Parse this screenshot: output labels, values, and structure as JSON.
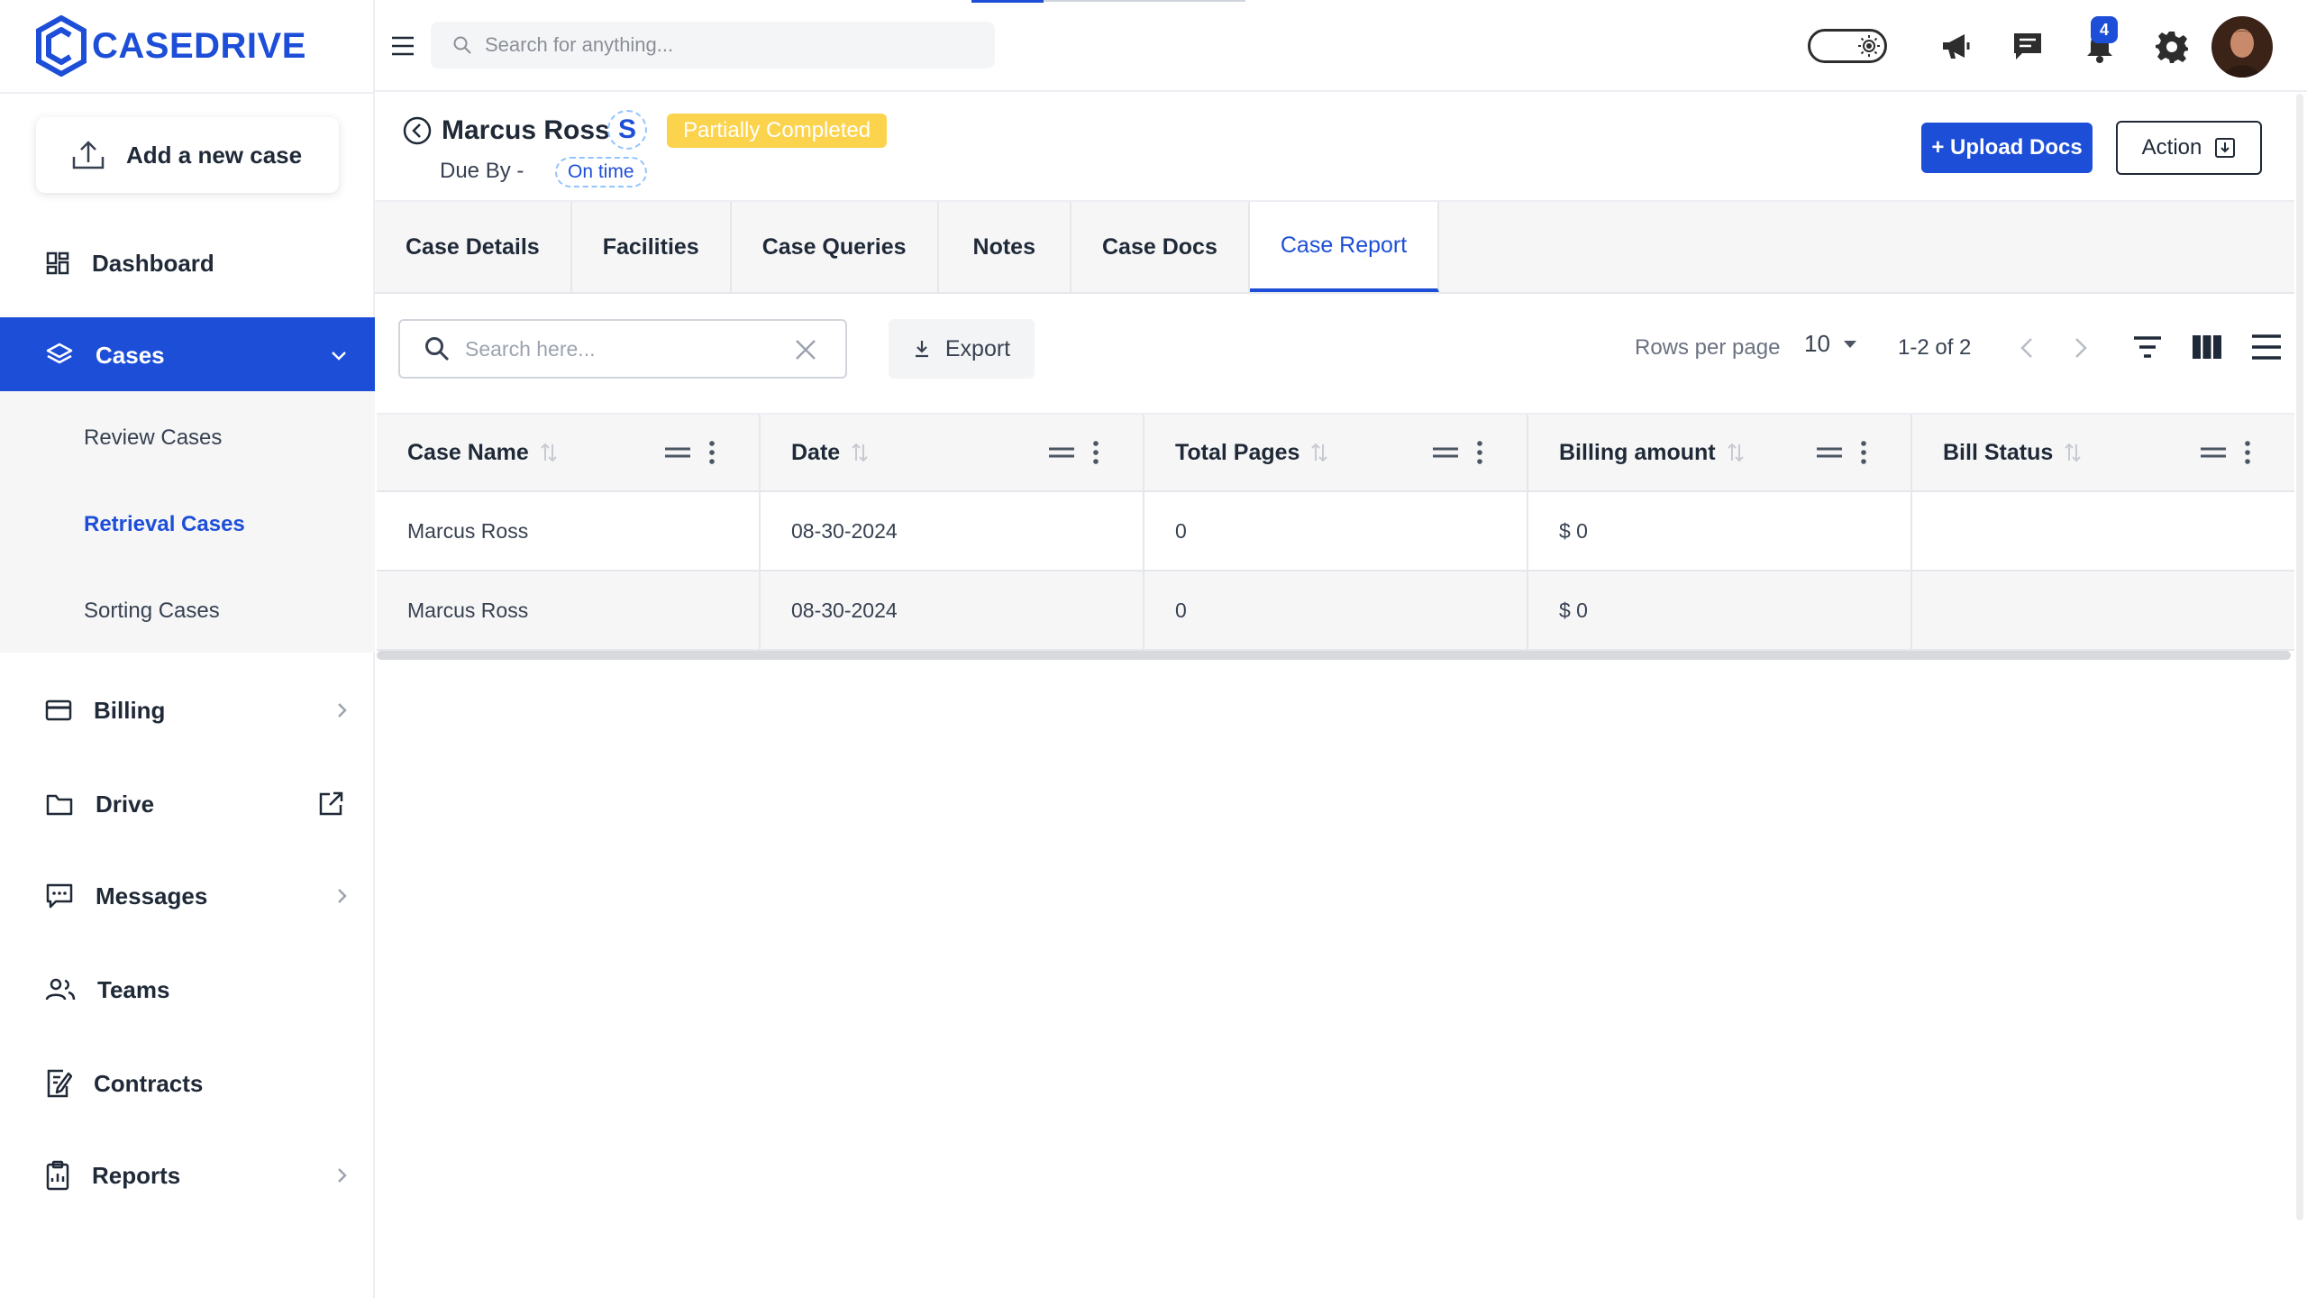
{
  "brand": {
    "logo_text": "CASEDRIVE",
    "accent": "#1d4ed8"
  },
  "sidebar": {
    "add_case_label": "Add a new case",
    "items": [
      {
        "label": "Dashboard"
      },
      {
        "label": "Cases"
      },
      {
        "label": "Billing"
      },
      {
        "label": "Drive"
      },
      {
        "label": "Messages"
      },
      {
        "label": "Teams"
      },
      {
        "label": "Contracts"
      },
      {
        "label": "Reports"
      }
    ],
    "cases_subitems": [
      {
        "label": "Review Cases"
      },
      {
        "label": "Retrieval Cases"
      },
      {
        "label": "Sorting Cases"
      }
    ]
  },
  "topbar": {
    "search_placeholder": "Search for anything...",
    "notification_count": "4"
  },
  "case": {
    "name": "Marcus Ross",
    "initial": "S",
    "status": "Partially Completed",
    "due_label": "Due By -",
    "due_status": "On time",
    "upload_label": "+ Upload Docs",
    "action_label": "Action"
  },
  "tabs": [
    {
      "label": "Case Details"
    },
    {
      "label": "Facilities"
    },
    {
      "label": "Case Queries"
    },
    {
      "label": "Notes"
    },
    {
      "label": "Case Docs"
    },
    {
      "label": "Case Report"
    }
  ],
  "toolbar": {
    "search_placeholder": "Search here...",
    "export_label": "Export",
    "rows_per_page_label": "Rows per page",
    "rows_per_page_value": "10",
    "range": "1-2 of 2"
  },
  "table": {
    "columns": [
      "Case Name",
      "Date",
      "Total Pages",
      "Billing amount",
      "Bill Status"
    ],
    "rows": [
      [
        "Marcus Ross",
        "08-30-2024",
        "0",
        "$ 0",
        ""
      ],
      [
        "Marcus Ross",
        "08-30-2024",
        "0",
        "$ 0",
        ""
      ]
    ]
  }
}
